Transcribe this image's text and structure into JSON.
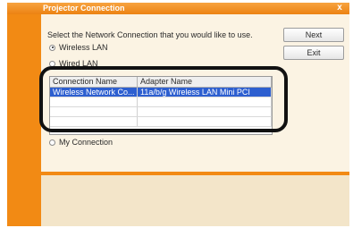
{
  "window": {
    "title": "Projector Connection",
    "close_glyph": "x"
  },
  "dialog": {
    "prompt": "Select the Network Connection that you would like to use.",
    "options": [
      {
        "label": "Wireless LAN",
        "selected": true
      },
      {
        "label": "Wired LAN",
        "selected": false
      },
      {
        "label": "My Connection",
        "selected": false
      }
    ],
    "buttons": {
      "next": "Next",
      "exit": "Exit"
    }
  },
  "table": {
    "headers": [
      "Connection Name",
      "Adapter Name"
    ],
    "rows": [
      [
        "Wireless Network Co...",
        "11a/b/g Wireless LAN Mini PCI"
      ]
    ]
  },
  "colors": {
    "accent": "#f28a14",
    "selection": "#2d5fd0"
  }
}
